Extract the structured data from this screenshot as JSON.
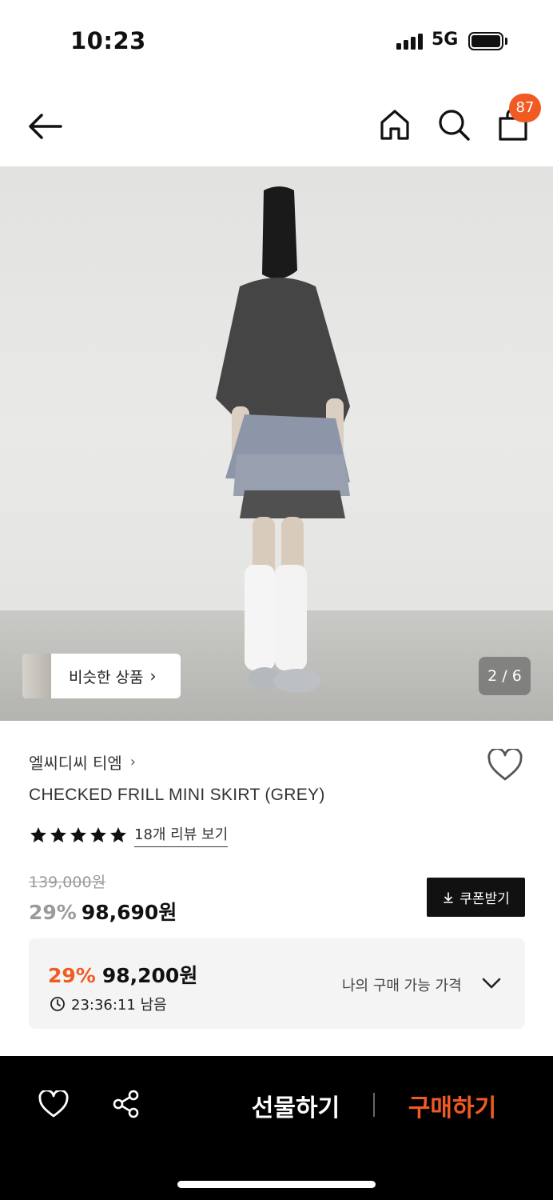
{
  "status": {
    "time": "10:23",
    "network": "5G"
  },
  "nav": {
    "cart_count": "87",
    "icons": [
      "arrow-left-icon",
      "home-icon",
      "search-icon",
      "shopping-bag-icon"
    ]
  },
  "gallery": {
    "similar_label": "비슷한 상품",
    "page_indicator": "2 / 6"
  },
  "product": {
    "brand": "엘씨디씨 티엠",
    "name": "CHECKED FRILL MINI SKIRT (GREY)",
    "rating_stars": 5,
    "review_link": "18개 리뷰 보기",
    "original_price": "139,000원",
    "discount_rate": "29%",
    "sale_price": "98,690원",
    "coupon_label": "쿠폰받기"
  },
  "promo": {
    "discount_rate": "29%",
    "price": "98,200원",
    "timer": "23:36:11 남음",
    "my_price_label": "나의 구매 가능 가격"
  },
  "bottom_bar": {
    "gift_label": "선물하기",
    "buy_label": "구매하기"
  },
  "colors": {
    "accent": "#f15a22",
    "bottom_bar": "#000000",
    "promo_bg": "#f4f4f4"
  }
}
